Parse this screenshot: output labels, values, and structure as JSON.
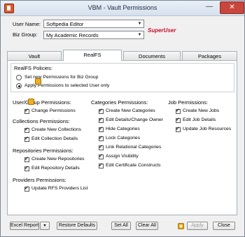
{
  "window": {
    "title": "VBM - Vault Permissions",
    "min_glyph": "—",
    "close_glyph": "✕"
  },
  "header": {
    "user_name_label": "User Name:",
    "user_name_value": "Softpedia Editor",
    "biz_group_label": "Biz Group:",
    "biz_group_value": "My Academic Records",
    "superuser_label": "SuperUser"
  },
  "tabs": [
    {
      "label": "Vault"
    },
    {
      "label": "RealFS",
      "active": true
    },
    {
      "label": "Documents"
    },
    {
      "label": "Packages"
    }
  ],
  "realfs_policies": {
    "title": "RealFS Policies:",
    "options": [
      {
        "label": "Set new Permissions for Biz Group",
        "selected": false
      },
      {
        "label": "Apply Permissions to selected User only",
        "selected": true
      }
    ]
  },
  "user_group_permissions": {
    "title": "User/Group Permissions:",
    "items": [
      {
        "label": "Change Permissions",
        "checked": true
      }
    ]
  },
  "collections_permissions": {
    "title": "Collections Permissions:",
    "items": [
      {
        "label": "Create New Collections",
        "checked": true
      },
      {
        "label": "Edit Collection Details",
        "checked": true
      }
    ]
  },
  "repositories_permissions": {
    "title": "Repositories Permissions:",
    "items": [
      {
        "label": "Create New Repositories",
        "checked": true
      },
      {
        "label": "Edit Repository Details",
        "checked": true
      }
    ]
  },
  "providers_permissions": {
    "title": "Providers Permissions:",
    "items": [
      {
        "label": "Update RFS Providers List",
        "checked": true
      }
    ]
  },
  "categories_permissions": {
    "title": "Categories Permissions:",
    "items": [
      {
        "label": "Create New Categories",
        "checked": true
      },
      {
        "label": "Edit Details/Change Owner",
        "checked": true
      },
      {
        "label": "Hide Categories",
        "checked": true
      },
      {
        "label": "Lock Categories",
        "checked": true
      },
      {
        "label": "Link Relational Categories",
        "checked": true
      },
      {
        "label": "Assign Visibility",
        "checked": true
      },
      {
        "label": "Edit Certificate Constructs",
        "checked": true
      }
    ]
  },
  "job_permissions": {
    "title": "Job Permissions:",
    "items": [
      {
        "label": "Create New Jobs",
        "checked": true
      },
      {
        "label": "Edit Job Details",
        "checked": true
      },
      {
        "label": "Update Job Resources",
        "checked": true
      }
    ]
  },
  "footer": {
    "excel_report": "Excel Report",
    "dropdown_glyph": "▼",
    "restore_defaults": "Restore Defaults",
    "set_all": "Set All",
    "clear_all": "Clear All",
    "apply": "Apply",
    "close": "Close"
  }
}
